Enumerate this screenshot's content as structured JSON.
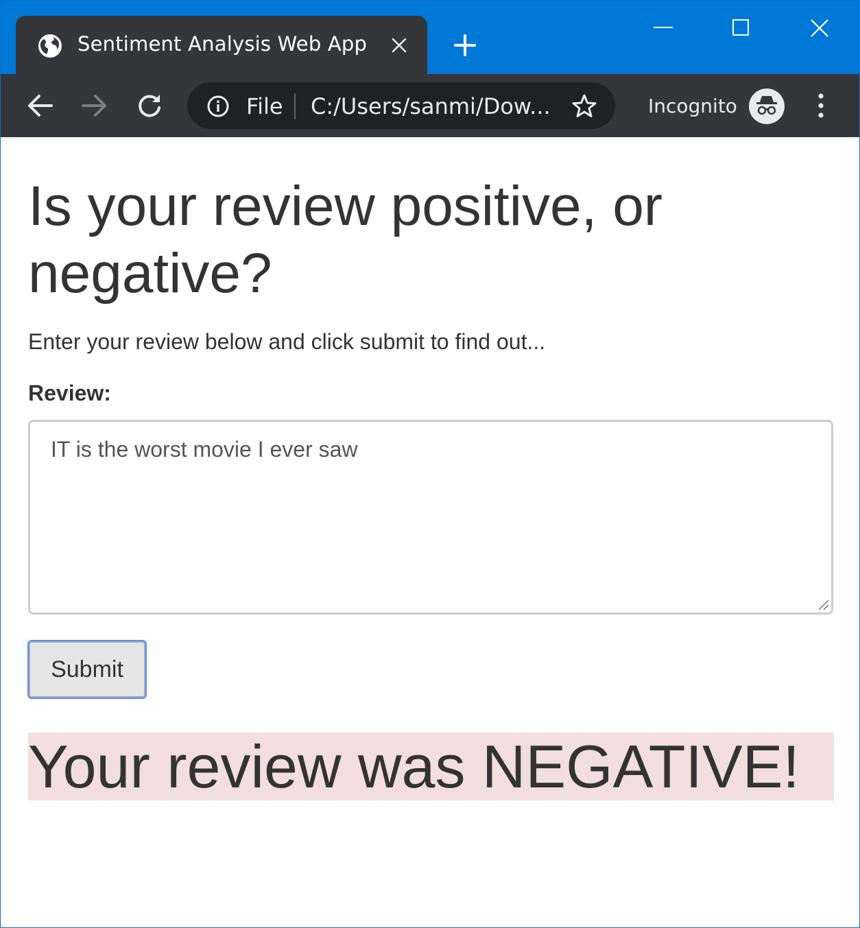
{
  "browser": {
    "tab_title": "Sentiment Analysis Web App",
    "omnibox_scheme": "File",
    "omnibox_url": "C:/Users/sanmi/Dow...",
    "incognito_label": "Incognito"
  },
  "icons": {
    "tab": "globe-icon",
    "tab_close": "close-icon",
    "new_tab": "plus-icon",
    "back": "arrow-left-icon",
    "forward": "arrow-right-icon",
    "reload": "reload-icon",
    "info": "info-icon",
    "bookmark": "star-icon",
    "incognito": "incognito-icon",
    "menu": "kebab-menu-icon"
  },
  "colors": {
    "titlebar": "#0078d7",
    "toolbar": "#35363a",
    "result_bg": "#f2dede",
    "text": "#333333"
  },
  "page": {
    "heading": "Is your review positive, or negative?",
    "intro": "Enter your review below and click submit to find out...",
    "review_label": "Review:",
    "review_value": "IT is the worst movie I ever saw",
    "submit_label": "Submit",
    "result": "Your review was NEGATIVE!"
  }
}
